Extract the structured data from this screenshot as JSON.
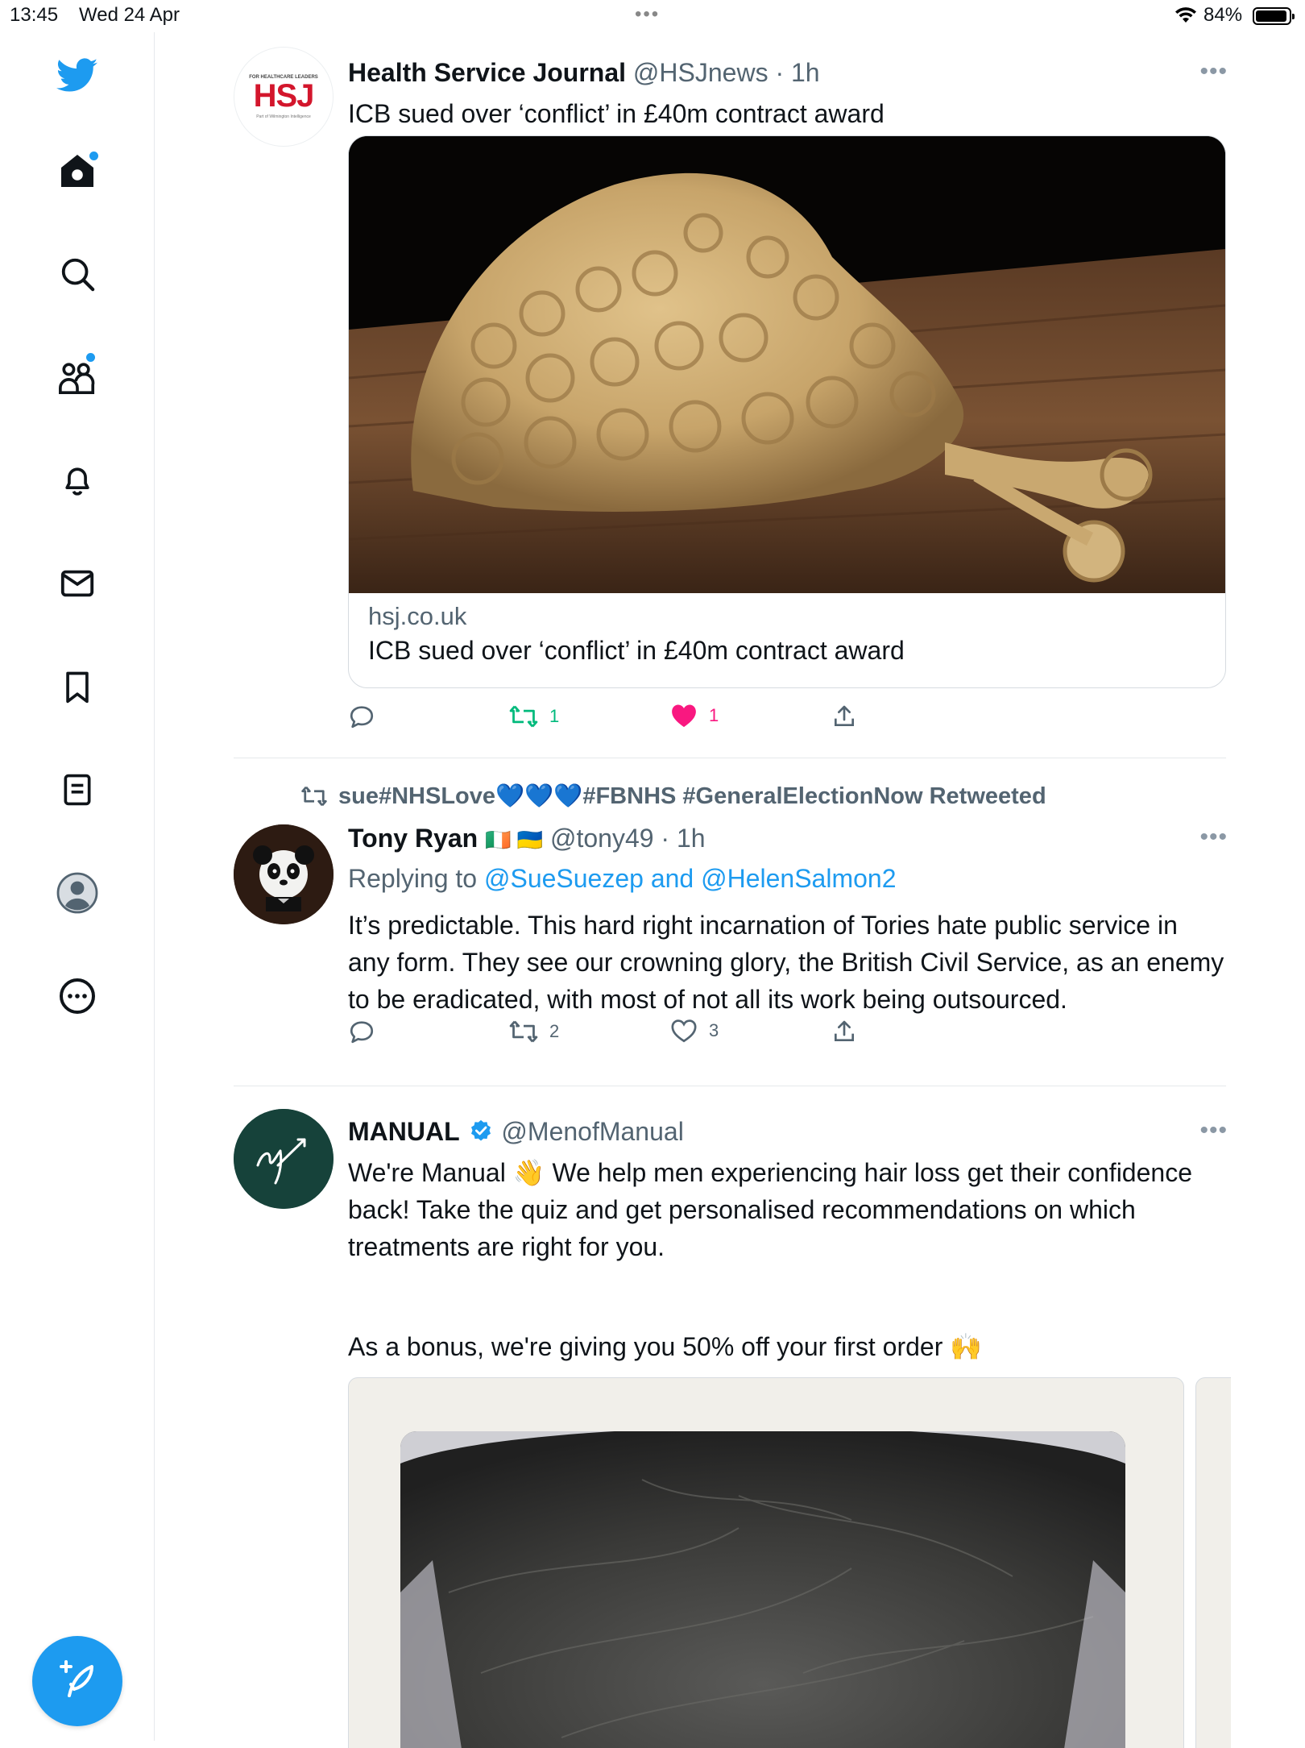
{
  "status_bar": {
    "time": "13:45",
    "date": "Wed 24 Apr",
    "battery": "84%",
    "battery_level": 0.84
  },
  "colors": {
    "accent": "#1d9bf0",
    "like": "#f91880",
    "retweet": "#00ba7c",
    "muted": "#536471"
  },
  "sidebar": {
    "items": [
      {
        "icon": "twitter-logo-icon"
      },
      {
        "icon": "home-icon",
        "has_dot": true
      },
      {
        "icon": "search-icon"
      },
      {
        "icon": "communities-icon",
        "has_dot": true
      },
      {
        "icon": "bell-icon"
      },
      {
        "icon": "mail-icon"
      },
      {
        "icon": "bookmark-icon"
      },
      {
        "icon": "lists-icon"
      },
      {
        "icon": "profile-icon"
      },
      {
        "icon": "more-circle-icon"
      }
    ],
    "compose_icon": "compose-tweet-icon"
  },
  "tweets": [
    {
      "name": "Health Service Journal",
      "handle": "@HSJnews",
      "time": "1h",
      "avatar_text": "HSJ",
      "avatar_top_text": "FOR HEALTHCARE LEADERS",
      "avatar_bottom_text": "Part of Wilmington Intelligence",
      "text": "ICB sued over ‘conflict’ in £40m contract award",
      "card": {
        "domain": "hsj.co.uk",
        "title": "ICB sued over ‘conflict’ in £40m contract award"
      },
      "reply_count": "",
      "retweet_count": "1",
      "like_count": "1",
      "liked": true,
      "retweeted": true
    },
    {
      "retweeted_by": "sue#NHSLove💙💙💙#FBNHS #GeneralElectionNow Retweeted",
      "name": "Tony Ryan",
      "name_flags": "🇮🇪 🇺🇦",
      "handle": "@tony49",
      "time": "1h",
      "replying_prefix": "Replying to",
      "replying_to": "@SueSuezep and @HelenSalmon2",
      "text": "It’s predictable. This hard right incarnation of Tories hate public service in any form. They see our crowning glory, the British Civil Service, as an enemy to be eradicated, with most of not all its work being outsourced.",
      "reply_count": "",
      "retweet_count": "2",
      "like_count": "3",
      "liked": false
    },
    {
      "name": "MANUAL",
      "verified": true,
      "handle": "@MenofManual",
      "text_1": "We're Manual 👋 We help men experiencing hair loss get their confidence back! Take the quiz and get personalised recommendations on which treatments are right for you.",
      "text_2": "As a bonus, we're giving you 50% off your first order 🙌"
    }
  ]
}
